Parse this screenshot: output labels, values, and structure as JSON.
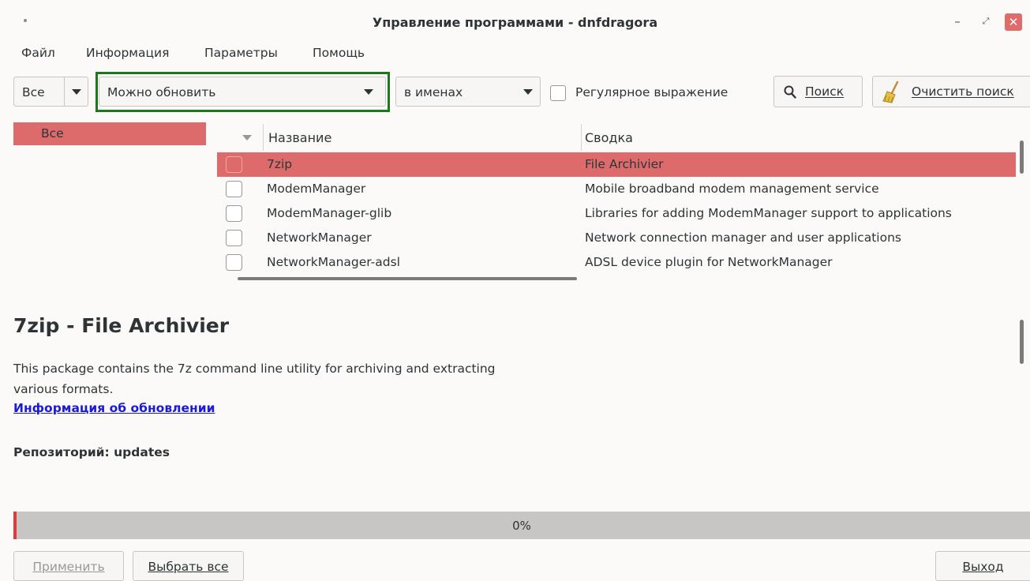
{
  "window": {
    "title": "Управление программами - dnfdragora"
  },
  "menu": [
    "Файл",
    "Информация",
    "Параметры",
    "Помощь"
  ],
  "toolbar": {
    "filter_all": "Все",
    "status_filter": "Можно обновить",
    "search_in": "в именах",
    "regex_label": "Регулярное выражение",
    "regex_checked": false,
    "search_button": "Поиск",
    "clear_button": "Очистить поиск"
  },
  "categories": [
    {
      "label": "Все",
      "selected": true
    }
  ],
  "table": {
    "columns": [
      "Название",
      "Сводка"
    ],
    "rows": [
      {
        "name": "7zip",
        "summary": "File Archivier",
        "checked": false,
        "selected": true
      },
      {
        "name": "ModemManager",
        "summary": "Mobile broadband modem management service",
        "checked": false,
        "selected": false
      },
      {
        "name": "ModemManager-glib",
        "summary": "Libraries for adding ModemManager support to applications",
        "checked": false,
        "selected": false
      },
      {
        "name": "NetworkManager",
        "summary": "Network connection manager and user applications",
        "checked": false,
        "selected": false
      },
      {
        "name": "NetworkManager-adsl",
        "summary": "ADSL device plugin for NetworkManager",
        "checked": false,
        "selected": false
      }
    ]
  },
  "details": {
    "title": "7zip - File Archivier",
    "description": "This package contains the 7z command line utility for archiving and extracting various formats.",
    "update_info_link": "Информация об обновлении",
    "repository": "Репозиторий: updates"
  },
  "progress": {
    "value": 0,
    "label": "0%"
  },
  "buttons": {
    "apply": "Применить",
    "select_all": "Выбрать все",
    "exit": "Выход"
  },
  "colors": {
    "selection": "#de6b6b",
    "highlight_border": "#1a7a1a",
    "link": "#1a1ad8",
    "progress_marker": "#e03a3a"
  }
}
